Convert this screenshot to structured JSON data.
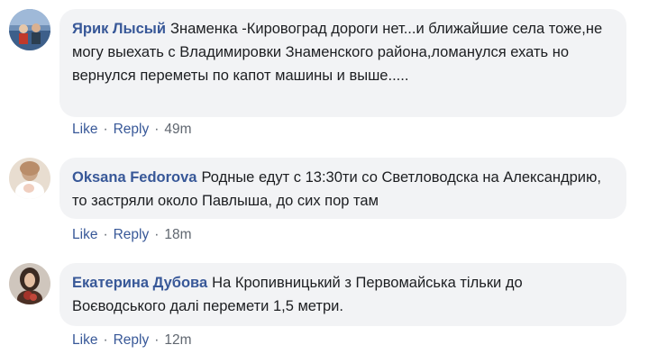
{
  "comments": [
    {
      "author": "Ярик Лысый",
      "text": "Знаменка -Кировоград дороги нет...и ближайшие села тоже,не могу выехать с Владимировки Знаменского района,ломанулся ехать но вернулся переметы по капот машины и выше.....",
      "like": "Like",
      "reply": "Reply",
      "sep": "·",
      "time": "49m",
      "avatar_icon": "user-avatar-icon"
    },
    {
      "author": "Oksana Fedorova",
      "text": "Родные едут с 13:30ти со Светловодска на Александрию, то застряли около Павлыша, до сих пор там",
      "like": "Like",
      "reply": "Reply",
      "sep": "·",
      "time": "18m",
      "avatar_icon": "user-avatar-icon"
    },
    {
      "author": "Екатерина Дубова",
      "text": "На Кропивницький з Первомайська тільки до Воєводського далі перемети 1,5 метри.",
      "like": "Like",
      "reply": "Reply",
      "sep": "·",
      "time": "12m",
      "avatar_icon": "user-avatar-icon"
    }
  ],
  "colors": {
    "author": "#385898",
    "bubble": "#f2f3f5",
    "meta": "#606770"
  }
}
